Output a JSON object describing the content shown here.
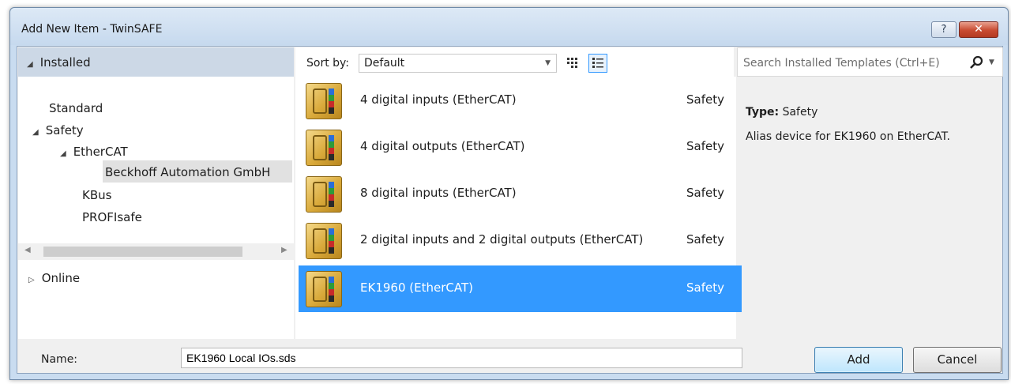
{
  "window": {
    "title": "Add New Item - TwinSAFE",
    "help_label": "?",
    "close_label": "✕"
  },
  "tree": {
    "installed_label": "Installed",
    "items": [
      {
        "label": "Standard"
      },
      {
        "label": "Safety"
      },
      {
        "label": "EtherCAT"
      },
      {
        "label": "Beckhoff Automation GmbH"
      },
      {
        "label": "KBus"
      },
      {
        "label": "PROFIsafe"
      }
    ],
    "online_label": "Online"
  },
  "sort": {
    "label": "Sort by:",
    "value": "Default"
  },
  "templates": [
    {
      "name": "4 digital inputs (EtherCAT)",
      "category": "Safety",
      "selected": false
    },
    {
      "name": "4 digital outputs (EtherCAT)",
      "category": "Safety",
      "selected": false
    },
    {
      "name": "8 digital inputs (EtherCAT)",
      "category": "Safety",
      "selected": false
    },
    {
      "name": "2 digital inputs and 2 digital outputs (EtherCAT)",
      "category": "Safety",
      "selected": false
    },
    {
      "name": "EK1960 (EtherCAT)",
      "category": "Safety",
      "selected": true
    }
  ],
  "search": {
    "placeholder": "Search Installed Templates (Ctrl+E)"
  },
  "details": {
    "type_label": "Type:",
    "type_value": "Safety",
    "description": "Alias device for EK1960 on EtherCAT."
  },
  "footer": {
    "name_label": "Name:",
    "name_value": "EK1960 Local IOs.sds",
    "add_label": "Add",
    "cancel_label": "Cancel"
  },
  "colors": {
    "selection": "#3399ff",
    "header": "#ccd8e6",
    "close_button": "#c84b31"
  }
}
